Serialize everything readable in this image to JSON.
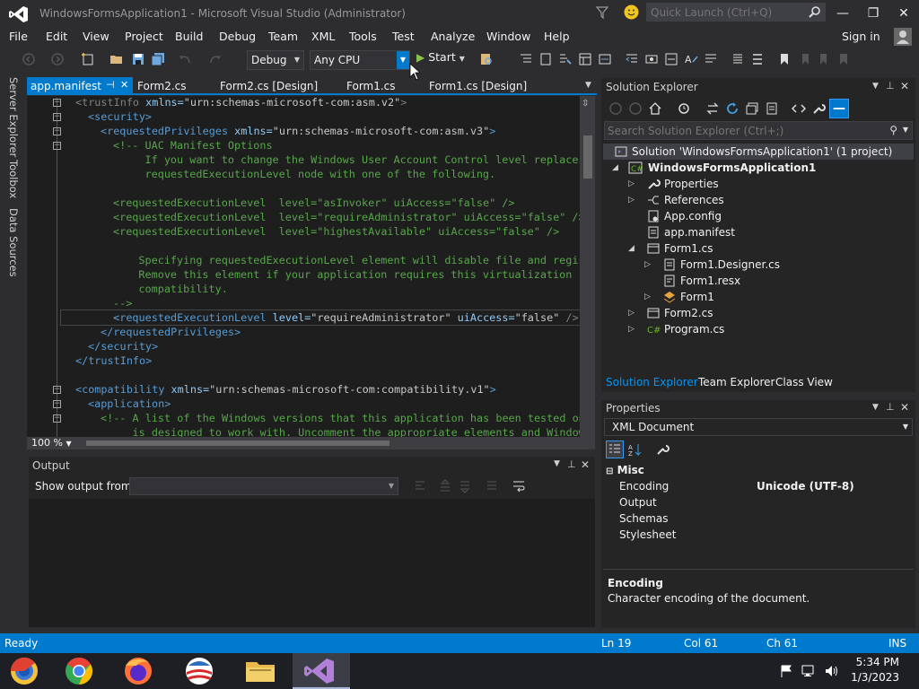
{
  "window": {
    "title": "WindowsFormsApplication1 - Microsoft Visual Studio (Administrator)",
    "quick_launch_placeholder": "Quick Launch (Ctrl+Q)",
    "minimize": "—",
    "maximize": "❐",
    "close": "✕"
  },
  "menu": [
    "File",
    "Edit",
    "View",
    "Project",
    "Build",
    "Debug",
    "Team",
    "XML",
    "Tools",
    "Test",
    "Analyze",
    "Window",
    "Help"
  ],
  "signin": "Sign in",
  "toolbar": {
    "config": "Debug",
    "platform": "Any CPU",
    "start": "Start"
  },
  "left_tabs": [
    "Server Explorer",
    "Toolbox",
    "Data Sources"
  ],
  "doc_tabs": [
    {
      "label": "app.manifest",
      "active": true
    },
    {
      "label": "Form2.cs",
      "active": false
    },
    {
      "label": "Form2.cs [Design]",
      "active": false
    },
    {
      "label": "Form1.cs",
      "active": false
    },
    {
      "label": "Form1.cs [Design]",
      "active": false
    }
  ],
  "code": {
    "l1_tag": "<trustInfo",
    "l1_attr": " xmlns=",
    "l1_val": "\"urn:schemas-microsoft-com:asm.v2\"",
    "l1_end": ">",
    "l2": "<security>",
    "l3_tag": "<requestedPrivileges",
    "l3_attr": " xmlns=",
    "l3_val": "\"urn:schemas-microsoft-com:asm.v3\"",
    "l3_end": ">",
    "l4": "<!-- UAC Manifest Options",
    "l5": "     If you want to change the Windows User Account Control level replace the",
    "l6": "     requestedExecutionLevel node with one of the following.",
    "l8_tag": "<requestedExecutionLevel",
    "l8_attr1": "  level=",
    "l8_val1": "\"asInvoker\"",
    "l8_attr2": " uiAccess=",
    "l8_val2": "\"false\"",
    "l8_end": " />",
    "l9_val1": "\"requireAdministrator\"",
    "l10_val1": "\"highestAvailable\"",
    "l12": "    Specifying requestedExecutionLevel element will disable file and registry virtualization.",
    "l13": "    Remove this element if your application requires this virtualization for backwards",
    "l14": "    compatibility.",
    "l15": "-->",
    "l16_attr1": " level=",
    "l17": "</requestedPrivileges>",
    "l18": "</security>",
    "l19": "</trustInfo>",
    "l21_tag": "<compatibility",
    "l21_val": "\"urn:schemas-microsoft-com:compatibility.v1\"",
    "l22": "<application>",
    "l23": "<!-- A list of the Windows versions that this application has been tested on and",
    "l24": "     is designed to work with. Uncomment the appropriate elements and Windows will"
  },
  "zoom": "100 %",
  "output": {
    "title": "Output",
    "show_from": "Show output from:"
  },
  "solution_explorer": {
    "title": "Solution Explorer",
    "search_placeholder": "Search Solution Explorer (Ctrl+;)",
    "items": [
      "Solution 'WindowsFormsApplication1' (1 project)",
      "WindowsFormsApplication1",
      "Properties",
      "References",
      "App.config",
      "app.manifest",
      "Form1.cs",
      "Form1.Designer.cs",
      "Form1.resx",
      "Form1",
      "Form2.cs",
      "Program.cs"
    ],
    "tabs": [
      "Solution Explorer",
      "Team Explorer",
      "Class View"
    ]
  },
  "properties": {
    "title": "Properties",
    "object": "XML Document",
    "category": "Misc",
    "rows": [
      {
        "name": "Encoding",
        "value": "Unicode (UTF-8)"
      },
      {
        "name": "Output",
        "value": ""
      },
      {
        "name": "Schemas",
        "value": ""
      },
      {
        "name": "Stylesheet",
        "value": ""
      }
    ],
    "desc_title": "Encoding",
    "desc_text": "Character encoding of the document."
  },
  "status": {
    "ready": "Ready",
    "ln": "Ln 19",
    "col": "Col 61",
    "ch": "Ch 61",
    "ins": "INS"
  },
  "clock": {
    "time": "5:34 PM",
    "date": "1/3/2023"
  }
}
